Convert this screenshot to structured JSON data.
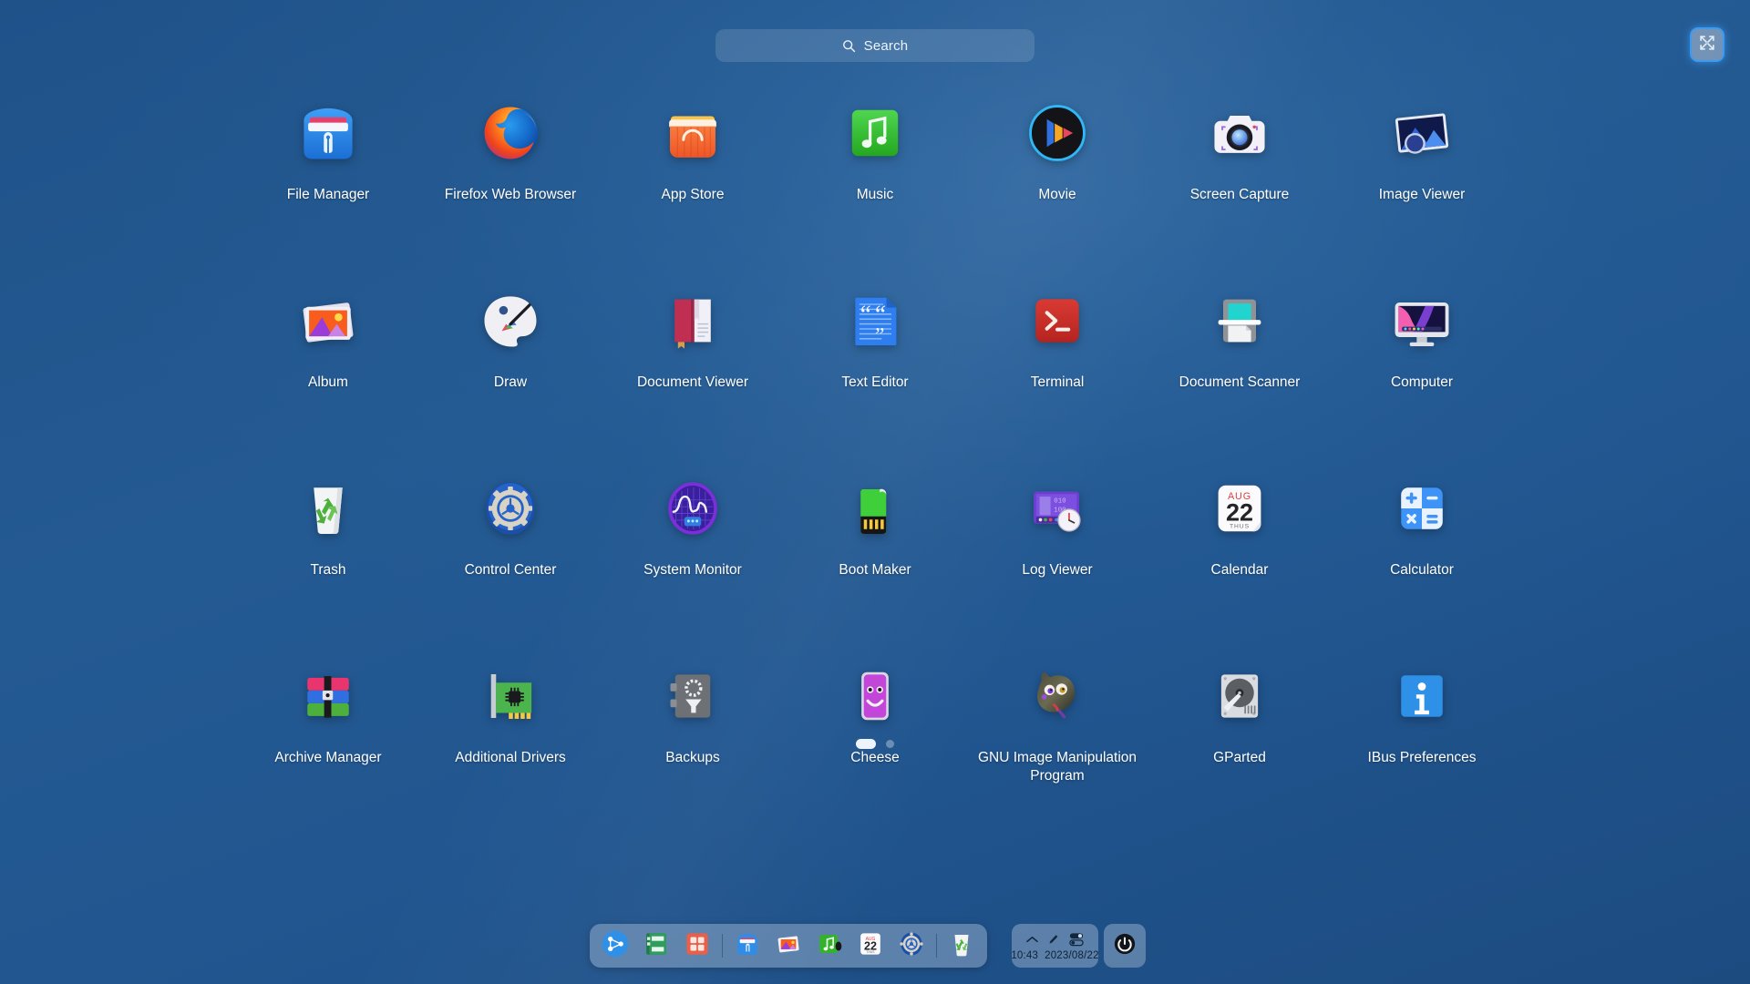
{
  "desktop": {
    "background_color": "#215690",
    "accent_color": "#3c9bf0"
  },
  "search": {
    "placeholder": "Search",
    "icon": "search-icon"
  },
  "window_controls": {
    "collapse_label": "Collapse",
    "icon": "collapse-arrows-icon"
  },
  "apps": [
    {
      "label": "File Manager",
      "icon": "file-manager-icon"
    },
    {
      "label": "Firefox Web Browser",
      "icon": "firefox-icon"
    },
    {
      "label": "App Store",
      "icon": "app-store-icon"
    },
    {
      "label": "Music",
      "icon": "music-icon"
    },
    {
      "label": "Movie",
      "icon": "movie-icon"
    },
    {
      "label": "Screen Capture",
      "icon": "screen-capture-icon"
    },
    {
      "label": "Image Viewer",
      "icon": "image-viewer-icon"
    },
    {
      "label": "Album",
      "icon": "album-icon"
    },
    {
      "label": "Draw",
      "icon": "draw-icon"
    },
    {
      "label": "Document Viewer",
      "icon": "document-viewer-icon"
    },
    {
      "label": "Text Editor",
      "icon": "text-editor-icon"
    },
    {
      "label": "Terminal",
      "icon": "terminal-icon"
    },
    {
      "label": "Document Scanner",
      "icon": "document-scanner-icon"
    },
    {
      "label": "Computer",
      "icon": "computer-icon"
    },
    {
      "label": "Trash",
      "icon": "trash-icon"
    },
    {
      "label": "Control Center",
      "icon": "control-center-icon"
    },
    {
      "label": "System Monitor",
      "icon": "system-monitor-icon"
    },
    {
      "label": "Boot Maker",
      "icon": "boot-maker-icon"
    },
    {
      "label": "Log Viewer",
      "icon": "log-viewer-icon"
    },
    {
      "label": "Calendar",
      "icon": "calendar-icon"
    },
    {
      "label": "Calculator",
      "icon": "calculator-icon"
    },
    {
      "label": "Archive Manager",
      "icon": "archive-manager-icon"
    },
    {
      "label": "Additional Drivers",
      "icon": "additional-drivers-icon"
    },
    {
      "label": "Backups",
      "icon": "backups-icon"
    },
    {
      "label": "Cheese",
      "icon": "cheese-icon"
    },
    {
      "label": "GNU Image Manipulation Program",
      "icon": "gimp-icon"
    },
    {
      "label": "GParted",
      "icon": "gparted-icon"
    },
    {
      "label": "IBus Preferences",
      "icon": "ibus-preferences-icon"
    }
  ],
  "calendar_icon": {
    "month": "AUG",
    "day": "22",
    "weekday": "THUS"
  },
  "pager": {
    "pages": 2,
    "active_page": 1
  },
  "dock": {
    "items": [
      {
        "name": "deepin-launcher-icon",
        "label": "Launcher"
      },
      {
        "name": "dictionary-icon",
        "label": "Dictionary"
      },
      {
        "name": "app-grid-icon",
        "label": "Applications"
      },
      {
        "name": "file-manager-icon",
        "label": "File Manager"
      },
      {
        "name": "album-icon",
        "label": "Album"
      },
      {
        "name": "music-icon",
        "label": "Music"
      },
      {
        "name": "calendar-icon",
        "label": "Calendar"
      },
      {
        "name": "control-center-icon",
        "label": "Control Center"
      },
      {
        "name": "trash-icon",
        "label": "Trash"
      }
    ]
  },
  "tray": {
    "icons": [
      {
        "name": "chevron-up-icon",
        "label": "Show hidden icons"
      },
      {
        "name": "brightness-pen-icon",
        "label": "Display"
      },
      {
        "name": "toggle-switch-icon",
        "label": "Settings toggle"
      }
    ],
    "time": "10:43",
    "date": "2023/08/22",
    "power_label": "Power"
  }
}
